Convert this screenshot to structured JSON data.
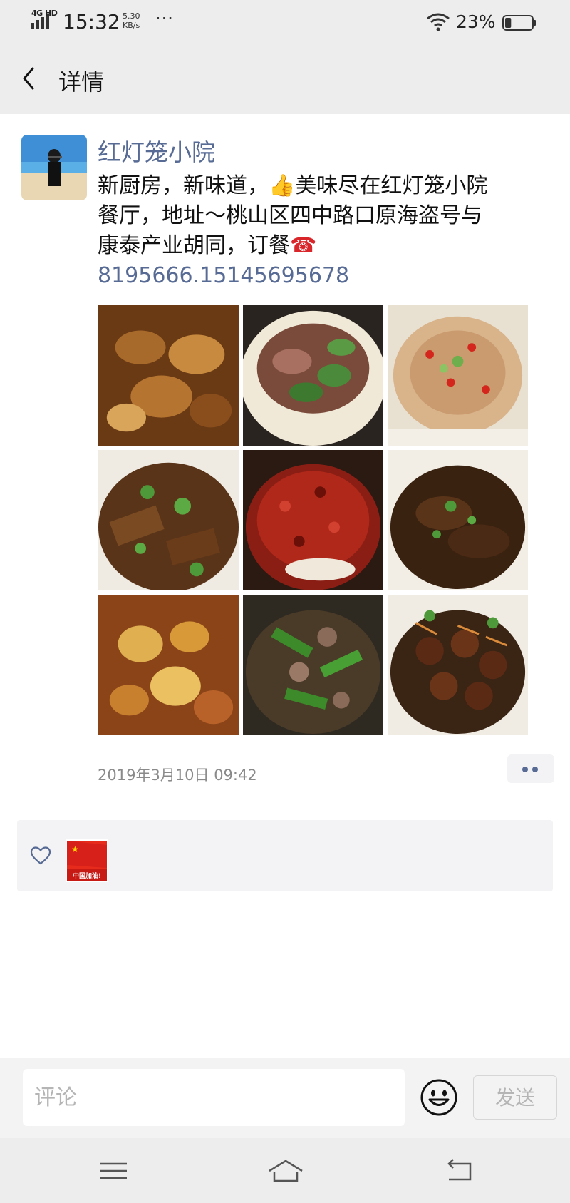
{
  "status_bar": {
    "network": "4G HD",
    "time": "15:32",
    "speed_value": "5.30",
    "speed_unit": "KB/s",
    "more": "···",
    "battery_percent": "23%",
    "battery_level": 0.23
  },
  "nav": {
    "title": "详情",
    "back_icon": "chevron-left-icon"
  },
  "post": {
    "author": "红灯笼小院",
    "text_1": "新厨房，新味道，",
    "emoji_thumb": "👍",
    "text_2": "美味尽在红灯笼小院餐厅，地址～桃山区四中路口原海盗号与康泰产业胡同，订餐",
    "emoji_phone": "☎",
    "phone": "8195666.15145695678",
    "timestamp": "2019年3月10日 09:42",
    "more_icon": "more-dots-icon",
    "images": [
      {
        "label": "dish-1"
      },
      {
        "label": "dish-2"
      },
      {
        "label": "dish-3"
      },
      {
        "label": "dish-4"
      },
      {
        "label": "dish-5"
      },
      {
        "label": "dish-6"
      },
      {
        "label": "dish-7"
      },
      {
        "label": "dish-8"
      },
      {
        "label": "dish-9"
      }
    ]
  },
  "likes": {
    "heart_icon": "heart-outline-icon",
    "liker_badge_text": "中国加油!"
  },
  "comment_bar": {
    "placeholder": "评论",
    "send_label": "发送",
    "emoji_icon": "smiley-icon"
  },
  "system_nav": {
    "menu_icon": "menu-icon",
    "home_icon": "home-icon",
    "back_icon": "return-icon"
  },
  "colors": {
    "link": "#576b95",
    "bar_bg": "#ededed"
  }
}
